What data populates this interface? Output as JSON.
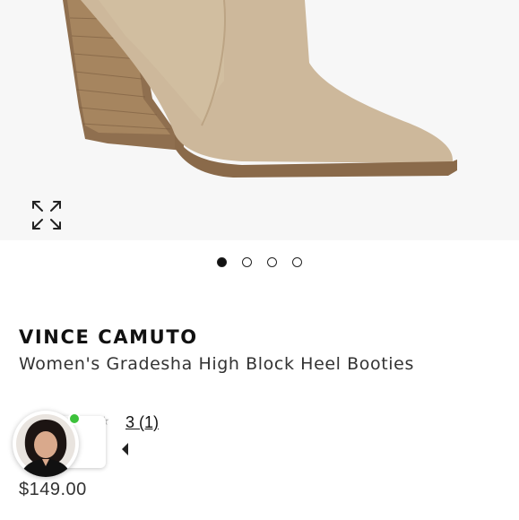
{
  "product": {
    "brand": "VINCE CAMUTO",
    "title": "Women's Gradesha High Block Heel Booties",
    "rating_text": "3 (1)",
    "price": "$149.00"
  },
  "gallery": {
    "image_count": 4,
    "active_index": 0,
    "expand_icon": "expand-icon"
  },
  "chat": {
    "status": "online",
    "status_color": "#3cc13b"
  },
  "colors": {
    "boot_suede": "#cdb89b",
    "heel_wood": "#9a7a58",
    "text": "#1a1a1a"
  }
}
